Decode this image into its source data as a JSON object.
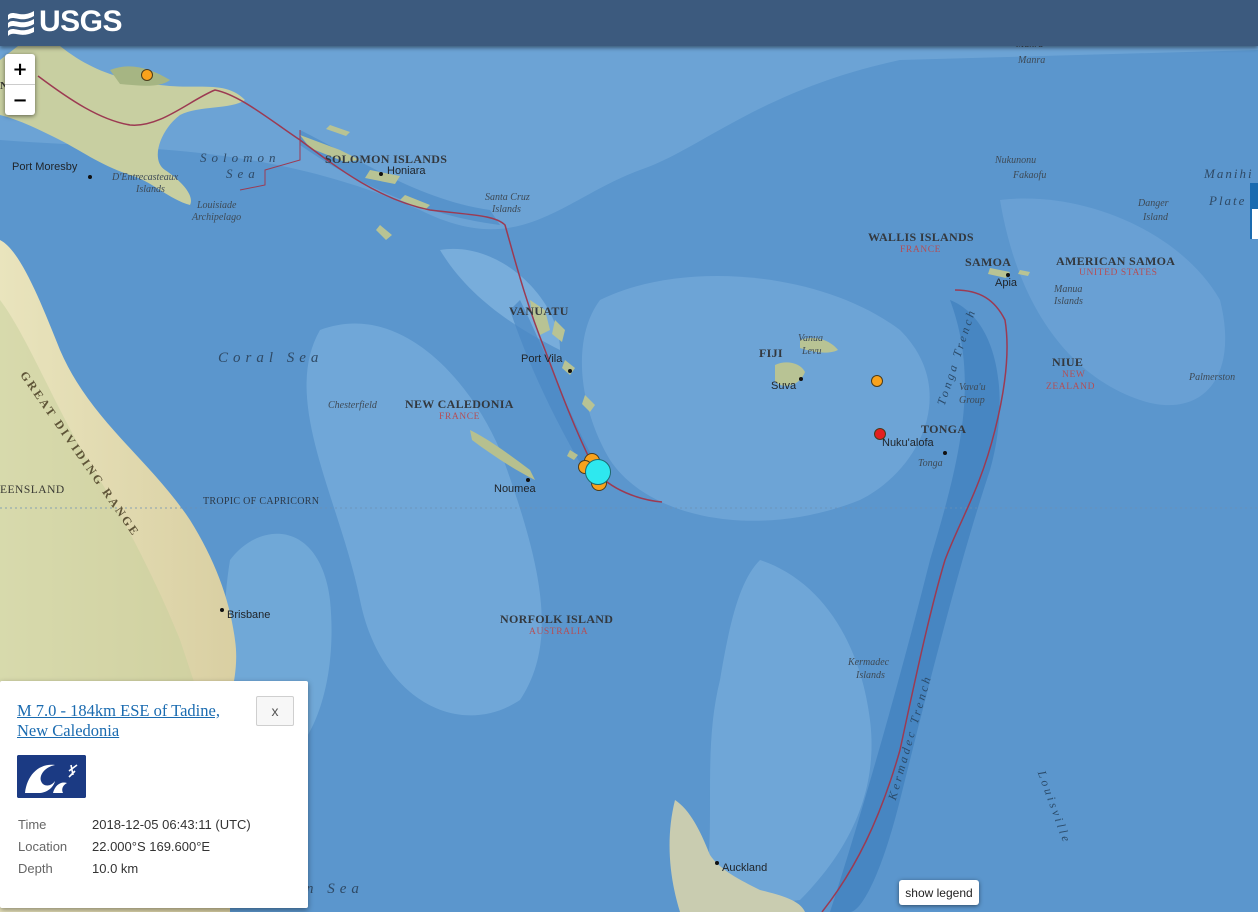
{
  "header": {
    "logo_text": "USGS",
    "logo_icon": "usgs-wave-icon"
  },
  "zoom": {
    "in_label": "+",
    "out_label": "−"
  },
  "map_labels": {
    "manra": "Manra",
    "nukunonu": "Nukunonu",
    "fakaofu": "Fakaofu",
    "manihi": "Manihi",
    "plate": "Plate",
    "danger": "Danger",
    "island": "Island",
    "port_moresby": "Port Moresby",
    "solomon": "Solomon",
    "sea_word": "Sea",
    "dentrecasteaux": "D'Entrecasteaux",
    "islands": "Islands",
    "louisiade": "Louisiade",
    "archipelago": "Archipelago",
    "solomon_islands": "SOLOMON ISLANDS",
    "honiara": "Honiara",
    "santa_cruz": "Santa Cruz",
    "santa_cruz_islands": "Islands",
    "wallis": "WALLIS ISLANDS",
    "wallis_owner": "FRANCE",
    "samoa": "SAMOA",
    "apia": "Apia",
    "american_samoa": "AMERICAN SAMOA",
    "american_samoa_owner": "UNITED STATES",
    "manua": "Manua",
    "manua_islands": "Islands",
    "vanuatu": "VANUATU",
    "port_vila": "Port Vila",
    "fiji": "FIJI",
    "vanua": "Vanua",
    "levu": "Levu",
    "suva": "Suva",
    "niue": "NIUE",
    "niue_owner_1": "NEW",
    "niue_owner_2": "ZEALAND",
    "palmerston": "Palmerston",
    "coral_sea": "Coral Sea",
    "chesterfield": "Chesterfield",
    "new_caledonia": "NEW CALEDONIA",
    "new_caledonia_owner": "FRANCE",
    "vavau": "Vava'u",
    "group": "Group",
    "tonga": "TONGA",
    "nukualofa": "Nuku'alofa",
    "tonga_place": "Tonga",
    "tonga_trench": "Tonga Trench",
    "noumea": "Noumea",
    "queensland": "QUEENSLAND",
    "tropic": "TROPIC OF CAPRICORN",
    "great_dividing_range": "GREAT DIVIDING RANGE",
    "brisbane": "Brisbane",
    "norfolk": "NORFOLK ISLAND",
    "norfolk_owner": "AUSTRALIA",
    "kermadec": "Kermadec",
    "kermadec_islands": "Islands",
    "kermadec_trench": "Kermadec Trench",
    "auckland": "Auckland",
    "louisville": "Louisville",
    "tasman_sea": "Tasman Sea",
    "png_fragment": "GUINEA NEW"
  },
  "earthquakes": [
    {
      "color": "#f9a21c",
      "icon": "earthquake-marker"
    },
    {
      "color": "#e31f1f",
      "icon": "earthquake-marker"
    },
    {
      "color": "#2ee8ef",
      "icon": "selected-earthquake-marker"
    }
  ],
  "popup": {
    "title": "M 7.0 - 184km ESE of Tadine, New Caledonia",
    "close_label": "x",
    "badge_icon": "tsunami-warning-icon",
    "rows": [
      {
        "key": "Time",
        "value": "2018-12-05 06:43:11 (UTC)"
      },
      {
        "key": "Location",
        "value": "22.000°S 169.600°E"
      },
      {
        "key": "Depth",
        "value": "10.0 km"
      }
    ]
  },
  "legend_button": "show legend"
}
